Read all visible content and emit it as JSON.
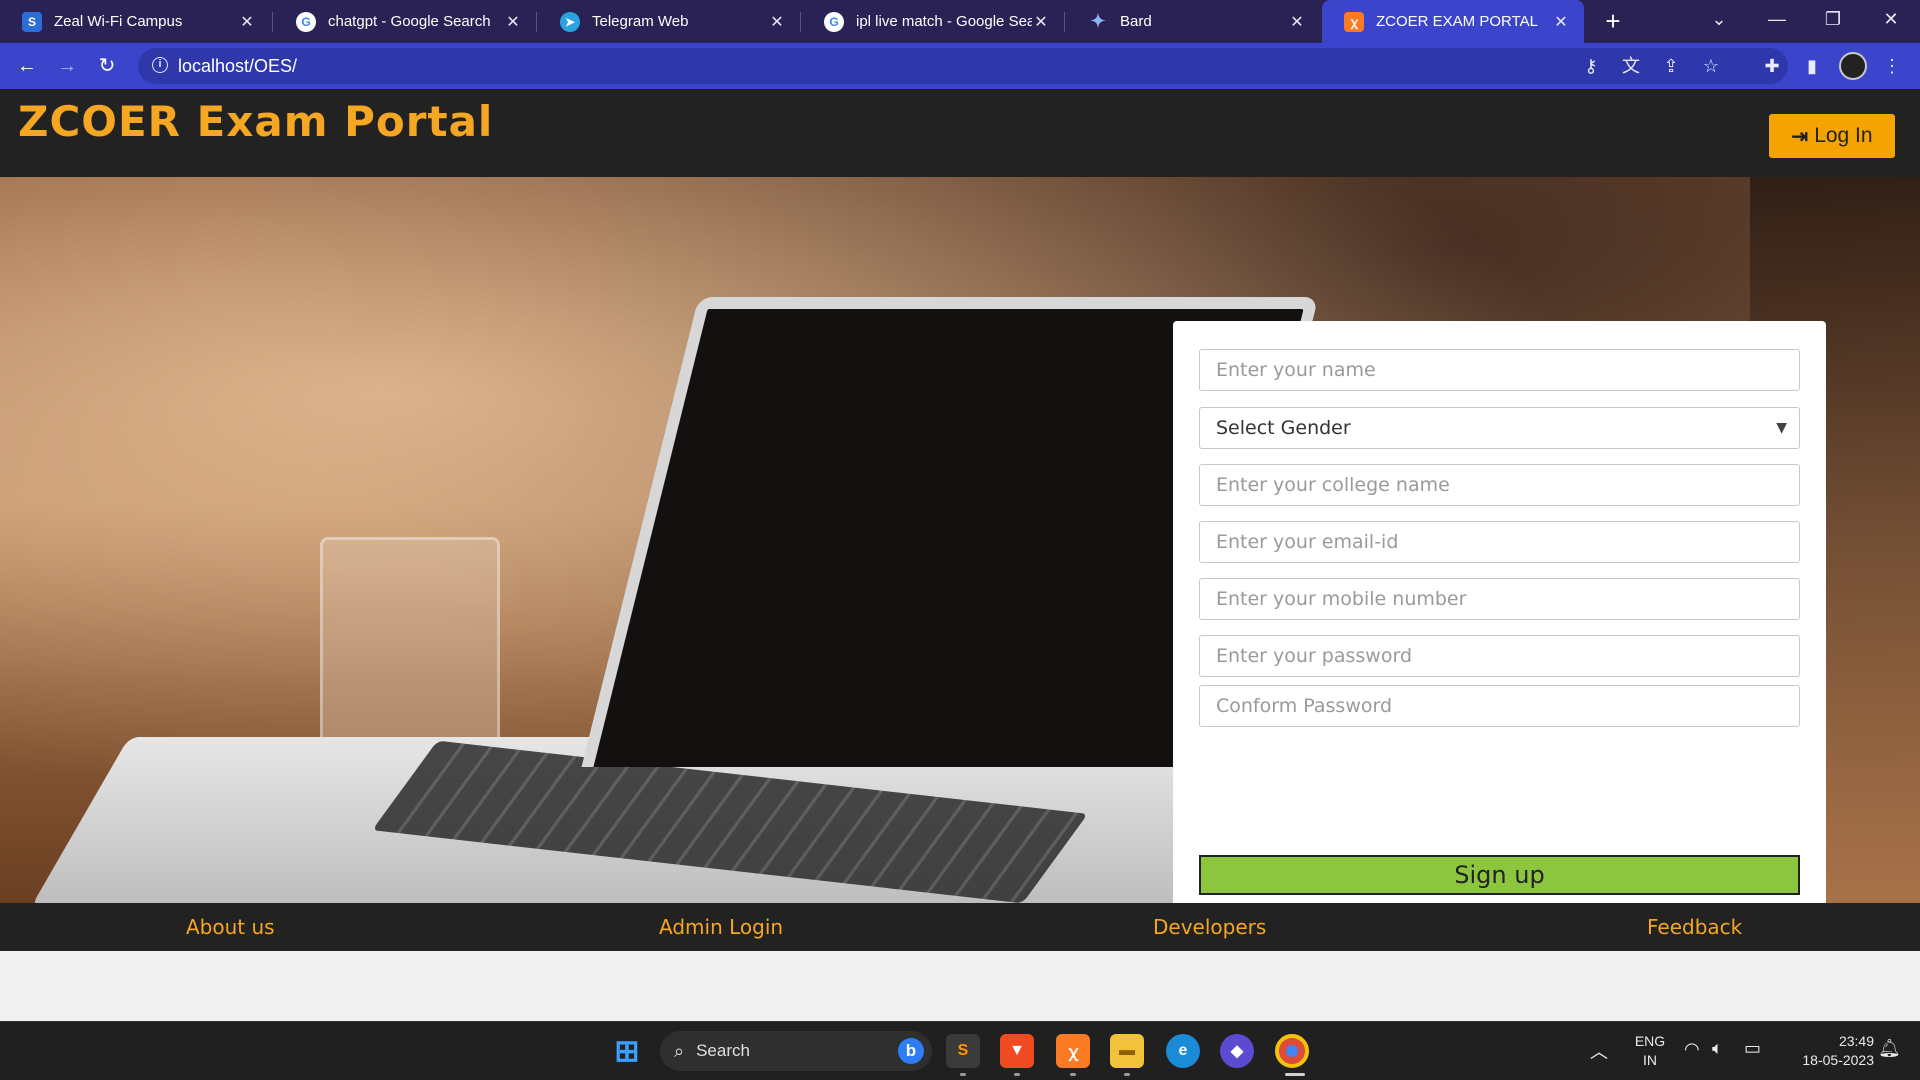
{
  "browser": {
    "tabs": [
      {
        "title": "Zeal Wi-Fi Campus",
        "icon": "zeal-s-icon",
        "active": false
      },
      {
        "title": "chatgpt - Google Search",
        "icon": "google-icon",
        "active": false
      },
      {
        "title": "Telegram Web",
        "icon": "telegram-icon",
        "active": false
      },
      {
        "title": "ipl live match - Google Sear",
        "icon": "google-icon",
        "active": false
      },
      {
        "title": "Bard",
        "icon": "bard-sparkle-icon",
        "active": false
      },
      {
        "title": "ZCOER EXAM PORTAL",
        "icon": "xampp-icon",
        "active": true
      }
    ],
    "url": "localhost/OES/",
    "accent": "#3b45cc"
  },
  "site": {
    "title": "ZCOER Exam Portal",
    "login_label": "Log In",
    "brand_color": "#f5a623"
  },
  "form": {
    "name_placeholder": "Enter your name",
    "gender_selected": "Select Gender",
    "college_placeholder": "Enter your college name",
    "email_placeholder": "Enter your email-id",
    "mobile_placeholder": "Enter your mobile number",
    "password_placeholder": "Enter your password",
    "confirm_placeholder": "Conform Password",
    "signup_label": "Sign up",
    "signup_color": "#8cc63f"
  },
  "footer": {
    "links": [
      "About us",
      "Admin Login",
      "Developers",
      "Feedback"
    ]
  },
  "taskbar": {
    "search_label": "Search",
    "language_top": "ENG",
    "language_bottom": "IN",
    "time": "23:49",
    "date": "18-05-2023"
  }
}
